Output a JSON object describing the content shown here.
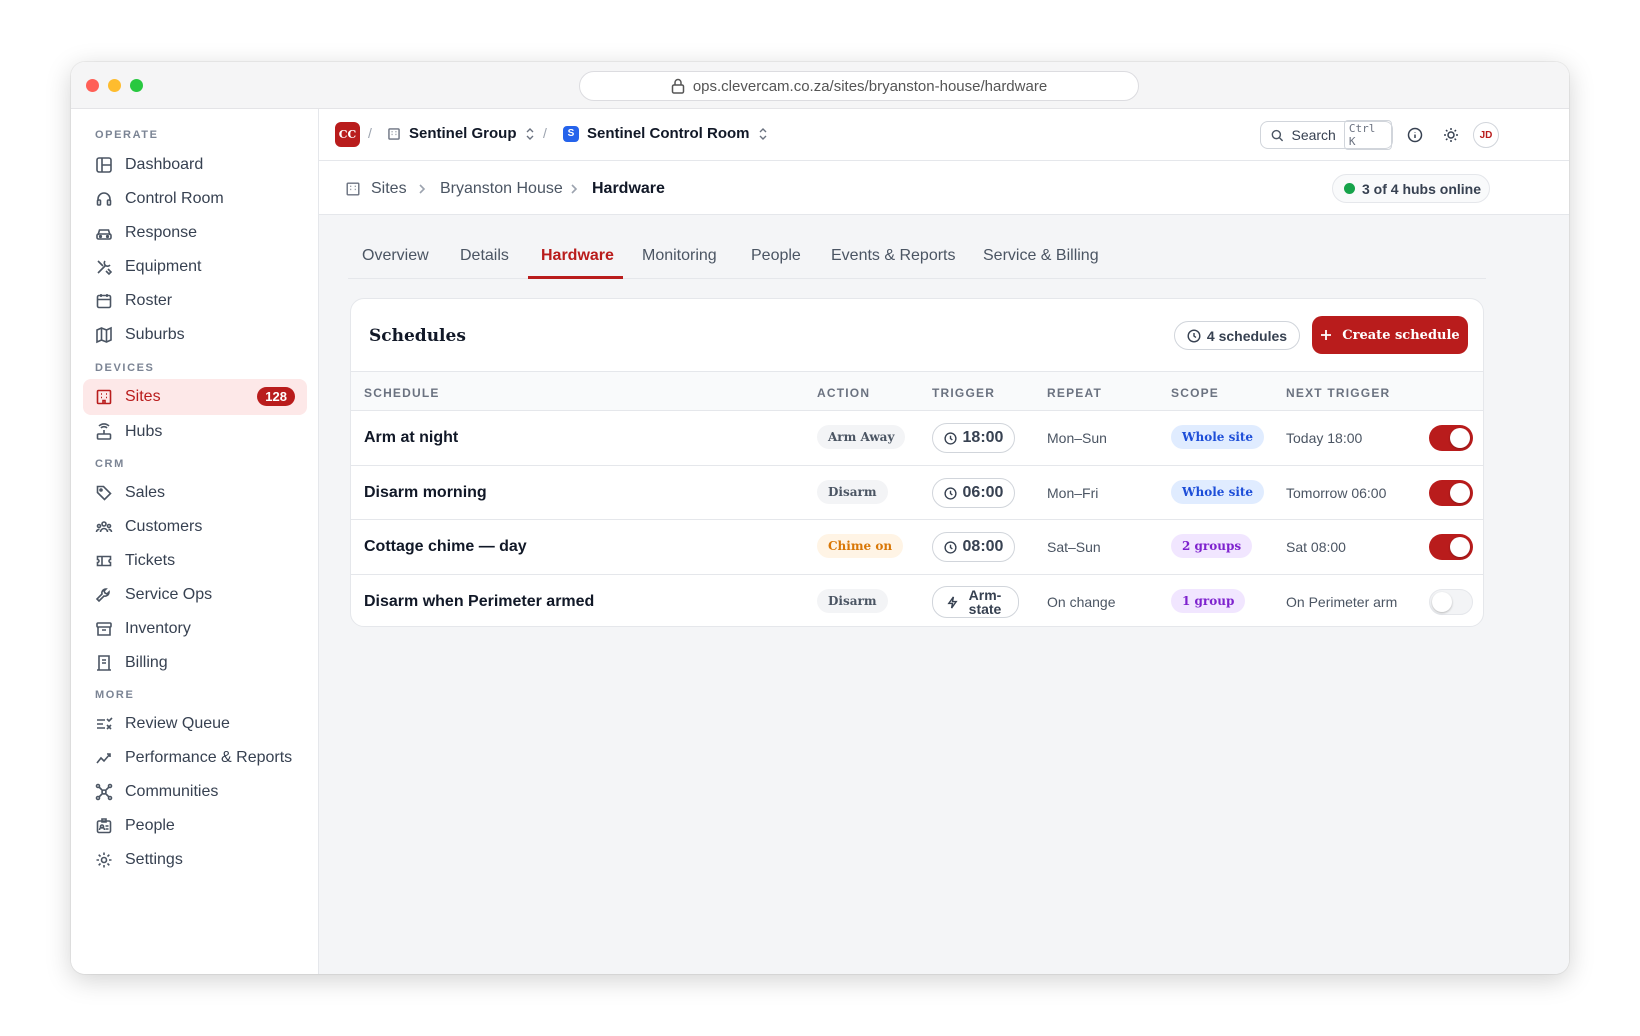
{
  "browser": {
    "url": "ops.clevercam.co.za/sites/bryanston-house/hardware"
  },
  "colors": {
    "brand": "#b91c1c",
    "online": "#16a34a",
    "workspace": "#2563eb"
  },
  "sidebar": {
    "sections": [
      "OPERATE",
      "DEVICES",
      "CRM",
      "MORE"
    ],
    "items": [
      {
        "label": "Dashboard",
        "icon": "layout-icon"
      },
      {
        "label": "Control Room",
        "icon": "headset-icon"
      },
      {
        "label": "Response",
        "icon": "car-icon"
      },
      {
        "label": "Equipment",
        "icon": "tools-icon"
      },
      {
        "label": "Roster",
        "icon": "calendar-icon"
      },
      {
        "label": "Suburbs",
        "icon": "map-icon"
      },
      {
        "label": "Sites",
        "icon": "building-icon",
        "badge": "128",
        "active": true
      },
      {
        "label": "Hubs",
        "icon": "router-icon"
      },
      {
        "label": "Sales",
        "icon": "tag-icon"
      },
      {
        "label": "Customers",
        "icon": "users-icon"
      },
      {
        "label": "Tickets",
        "icon": "ticket-icon"
      },
      {
        "label": "Service Ops",
        "icon": "wrench-icon"
      },
      {
        "label": "Inventory",
        "icon": "archive-icon"
      },
      {
        "label": "Billing",
        "icon": "receipt-icon"
      },
      {
        "label": "Review Queue",
        "icon": "list-check-icon"
      },
      {
        "label": "Performance & Reports",
        "icon": "trend-icon"
      },
      {
        "label": "Communities",
        "icon": "network-icon"
      },
      {
        "label": "People",
        "icon": "id-card-icon"
      },
      {
        "label": "Settings",
        "icon": "gear-icon"
      }
    ]
  },
  "topbar": {
    "logo": "CC",
    "org": "Sentinel Group",
    "workspace_badge": "S",
    "workspace": "Sentinel Control Room",
    "search_label": "Search",
    "search_shortcut": "Ctrl K",
    "avatar": "JD"
  },
  "breadcrumb": {
    "items": [
      "Sites",
      "Bryanston House",
      "Hardware"
    ],
    "status": "3 of 4 hubs online"
  },
  "tabs": [
    {
      "label": "Overview"
    },
    {
      "label": "Details"
    },
    {
      "label": "Hardware",
      "active": true
    },
    {
      "label": "Monitoring"
    },
    {
      "label": "People"
    },
    {
      "label": "Events & Reports"
    },
    {
      "label": "Service & Billing"
    }
  ],
  "schedules": {
    "title": "Schedules",
    "count": "4 schedules",
    "create_label": "Create schedule",
    "columns": [
      "SCHEDULE",
      "ACTION",
      "TRIGGER",
      "REPEAT",
      "SCOPE",
      "NEXT TRIGGER"
    ],
    "rows": [
      {
        "name": "Arm at night",
        "action": "Arm Away",
        "action_color": "gray",
        "trigger": "18:00",
        "trigger_icon": "clock-icon",
        "repeat": "Mon–Sun",
        "scope": "Whole site",
        "scope_color": "blue",
        "next": "Today 18:00",
        "enabled": true
      },
      {
        "name": "Disarm morning",
        "action": "Disarm",
        "action_color": "gray",
        "trigger": "06:00",
        "trigger_icon": "clock-icon",
        "repeat": "Mon–Fri",
        "scope": "Whole site",
        "scope_color": "blue",
        "next": "Tomorrow 06:00",
        "enabled": true
      },
      {
        "name": "Cottage chime — day",
        "action": "Chime on",
        "action_color": "amber",
        "trigger": "08:00",
        "trigger_icon": "clock-icon",
        "repeat": "Sat–Sun",
        "scope": "2 groups",
        "scope_color": "purple",
        "next": "Sat 08:00",
        "enabled": true
      },
      {
        "name": "Disarm when Perimeter armed",
        "action": "Disarm",
        "action_color": "gray",
        "trigger": "Arm-state",
        "trigger_icon": "bolt-icon",
        "repeat": "On change",
        "scope": "1 group",
        "scope_color": "purple",
        "next": "On Perimeter arm",
        "enabled": false
      }
    ]
  }
}
